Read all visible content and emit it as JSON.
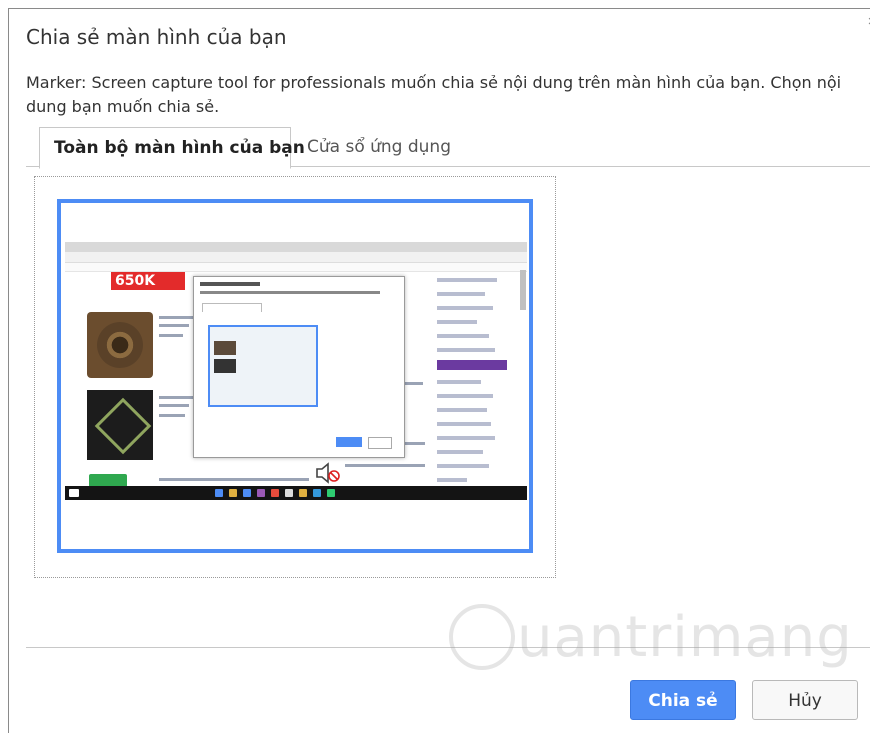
{
  "dialog": {
    "title": "Chia sẻ màn hình của bạn",
    "description": "Marker: Screen capture tool for professionals muốn chia sẻ nội dung trên màn hình của bạn. Chọn nội dung bạn muốn chia sẻ.",
    "close_symbol": "×"
  },
  "tabs": [
    {
      "label": "Toàn bộ màn hình của bạn",
      "selected": true
    },
    {
      "label": "Cửa sổ ứng dụng",
      "selected": false
    }
  ],
  "preview": {
    "selected_border_color": "#4d8cf5",
    "banner_text": "650K"
  },
  "buttons": {
    "share_label": "Chia sẻ",
    "cancel_label": "Hủy"
  },
  "watermark": {
    "text": "uantrimang"
  },
  "colors": {
    "accent": "#4d8cf5",
    "accent_border": "#3b78e0"
  }
}
